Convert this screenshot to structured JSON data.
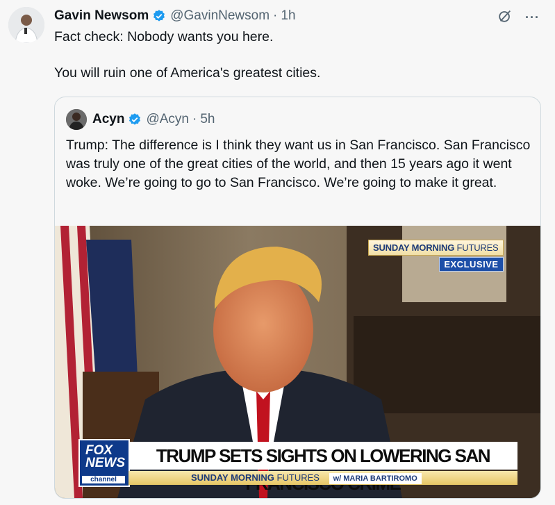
{
  "tweet": {
    "author_name": "Gavin Newsom",
    "handle": "@GavinNewsom",
    "separator": "·",
    "time": "1h",
    "text": "Fact check: Nobody wants you here.\n\nYou will ruin one of America's greatest cities.",
    "more_label": "···"
  },
  "quote": {
    "author_name": "Acyn",
    "handle": "@Acyn",
    "separator": "·",
    "time": "5h",
    "text": "Trump: The difference is I think they want us in San Francisco. San Francisco was truly one of the great cities of the world, and then 15 years ago it went woke. We’re going to go to San Francisco. We’re going to make it great.",
    "media": {
      "overlay_show_bold": "SUNDAY MORNING",
      "overlay_show_light": "FUTURES",
      "overlay_badge": "EXCLUSIVE",
      "logo_line1": "FOX",
      "logo_line2": "NEWS",
      "logo_line3": "channel",
      "chyron": "TRUMP SETS SIGHTS ON LOWERING SAN FRANCISCO CRIME",
      "sub_bold": "SUNDAY MORNING",
      "sub_light": "FUTURES",
      "sub_host": "w/ MARIA BARTIROMO"
    }
  },
  "colors": {
    "verified": "#1d9bf0",
    "fox_blue": "#0e3a8a"
  },
  "icons": [
    "verified-badge-icon",
    "grok-icon",
    "more-icon"
  ]
}
